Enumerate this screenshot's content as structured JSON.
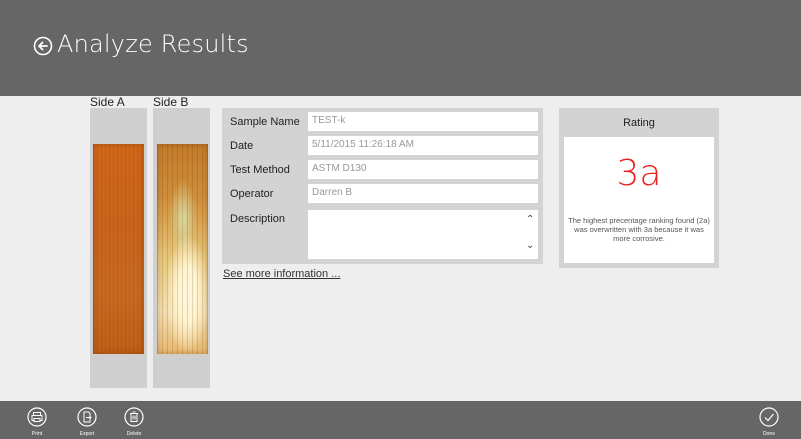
{
  "header": {
    "title": "Analyze Results",
    "back_icon": "back-arrow-circle-icon"
  },
  "sides": {
    "side_a_label": "Side A",
    "side_b_label": "Side B"
  },
  "sample_info": {
    "fields": [
      {
        "label": "Sample Name",
        "value": "TEST-k"
      },
      {
        "label": "Date",
        "value": "5/11/2015 11:26:18 AM"
      },
      {
        "label": "Test Method",
        "value": "ASTM D130"
      },
      {
        "label": "Operator",
        "value": "Darren B"
      }
    ],
    "description_label": "Description",
    "description_value": "",
    "see_more_link": "See more information ..."
  },
  "rating": {
    "title": "Rating",
    "value": "3a",
    "value_color": "#e8231e",
    "note": "The highest precentage ranking found (2a) was overwritten with 3a because it was more corrosive."
  },
  "appbar": {
    "left_buttons": [
      {
        "label": "Print",
        "icon": "printer-icon"
      },
      {
        "label": "Export",
        "icon": "export-document-icon"
      },
      {
        "label": "Delete",
        "icon": "trash-icon"
      }
    ],
    "right_button": {
      "label": "Done",
      "icon": "checkmark-circle-icon"
    }
  },
  "colors": {
    "header_bg": "#666666",
    "page_bg": "#eeeeee",
    "panel_bg": "#d3d3d3"
  }
}
